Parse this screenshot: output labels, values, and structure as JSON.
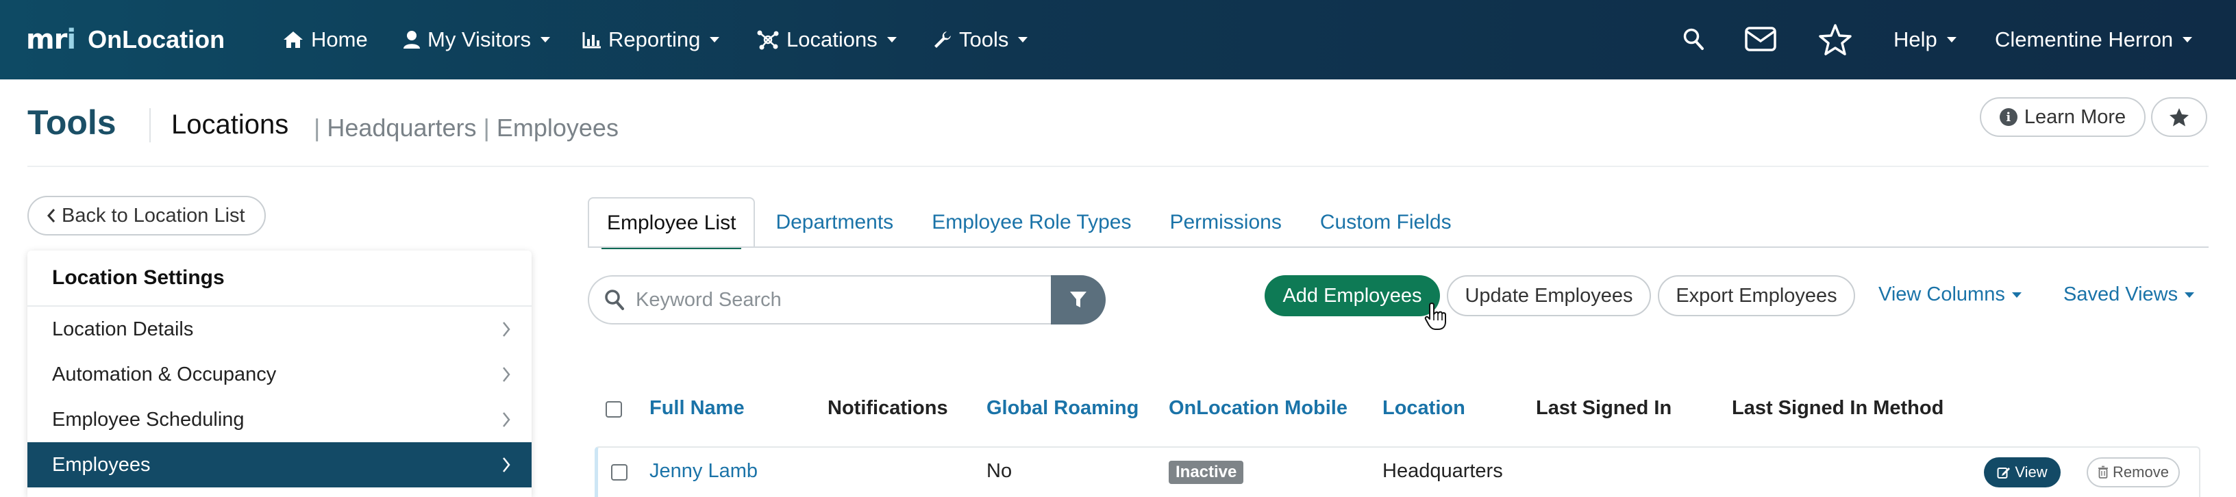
{
  "topnav": {
    "brand_mark": "mri",
    "brand_name": "OnLocation",
    "items": [
      {
        "label": "Home",
        "icon": "home-icon",
        "has_dropdown": false
      },
      {
        "label": "My Visitors",
        "icon": "user-icon",
        "has_dropdown": true
      },
      {
        "label": "Reporting",
        "icon": "bar-chart-icon",
        "has_dropdown": true
      },
      {
        "label": "Locations",
        "icon": "network-icon",
        "has_dropdown": true
      },
      {
        "label": "Tools",
        "icon": "wrench-icon",
        "has_dropdown": true
      }
    ],
    "right": {
      "search_icon": "search-icon",
      "mail_icon": "envelope-icon",
      "star_icon": "star-outline-icon",
      "help_label": "Help",
      "user_name": "Clementine Herron"
    }
  },
  "page": {
    "title": "Tools",
    "crumb_main": "Locations",
    "crumb_parts": [
      "Headquarters",
      "Employees"
    ],
    "learn_more_label": "Learn More",
    "favorite_icon": "star-icon"
  },
  "sidebar": {
    "back_label": "Back to Location List",
    "panel_title": "Location Settings",
    "items": [
      {
        "label": "Location Details",
        "active": false
      },
      {
        "label": "Automation & Occupancy",
        "active": false
      },
      {
        "label": "Employee Scheduling",
        "active": false
      },
      {
        "label": "Employees",
        "active": true
      }
    ]
  },
  "tabs": [
    {
      "label": "Employee List",
      "active": true
    },
    {
      "label": "Departments",
      "active": false
    },
    {
      "label": "Employee Role Types",
      "active": false
    },
    {
      "label": "Permissions",
      "active": false
    },
    {
      "label": "Custom Fields",
      "active": false
    }
  ],
  "toolbar": {
    "search_placeholder": "Keyword Search",
    "add_label": "Add Employees",
    "update_label": "Update Employees",
    "export_label": "Export Employees",
    "view_columns_label": "View Columns",
    "saved_views_label": "Saved Views"
  },
  "table": {
    "columns": [
      "Full Name",
      "Notifications",
      "Global Roaming",
      "OnLocation Mobile",
      "Location",
      "Last Signed In",
      "Last Signed In Method"
    ],
    "rows": [
      {
        "full_name": "Jenny Lamb",
        "notifications": "",
        "global_roaming": "No",
        "mobile_status": "Inactive",
        "location": "Headquarters",
        "last_signed_in": "",
        "last_signed_in_method": "",
        "view_label": "View",
        "remove_label": "Remove"
      }
    ]
  },
  "colors": {
    "nav_bg": "#0f3550",
    "primary_green": "#0e7a55",
    "link_blue": "#1a73a8",
    "active_sidebar": "#134a66",
    "title_color": "#1b4f66"
  }
}
